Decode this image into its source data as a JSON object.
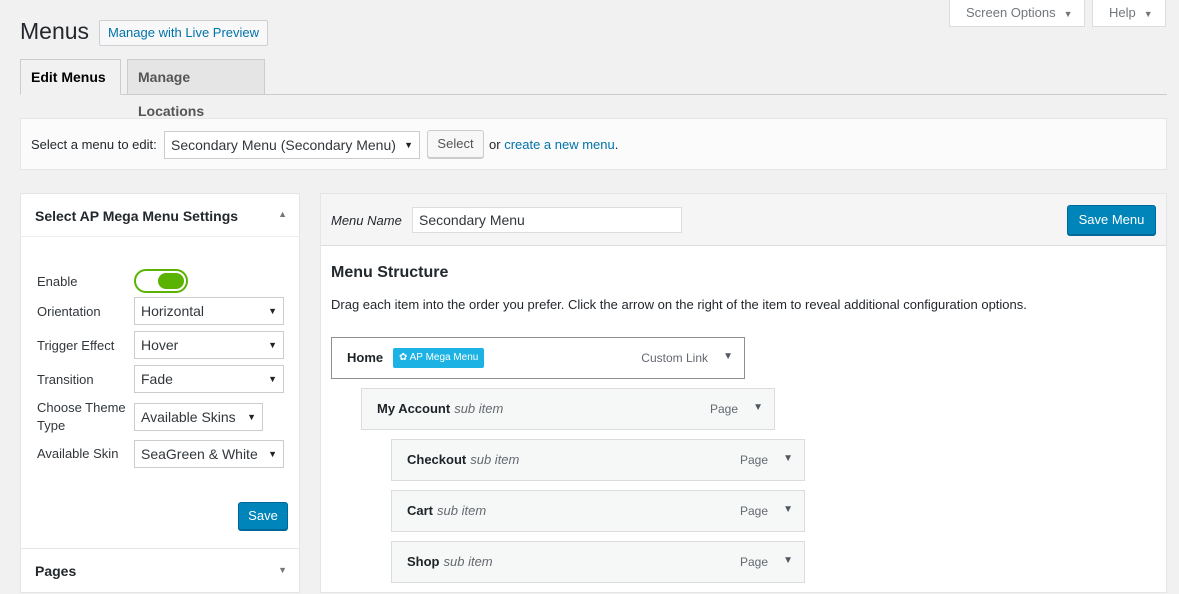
{
  "screen_options": {
    "label": "Screen Options"
  },
  "help": {
    "label": "Help"
  },
  "header": {
    "title": "Menus",
    "live_preview_label": "Manage with Live Preview"
  },
  "tabs": [
    {
      "label": "Edit Menus"
    },
    {
      "label": "Manage Locations"
    }
  ],
  "manage_menus": {
    "label": "Select a menu to edit:",
    "selected_menu": "Secondary Menu (Secondary Menu)",
    "select_button": "Select",
    "or_text": "or",
    "create_link": "create a new menu",
    "period": "."
  },
  "settings_panel": {
    "title": "Select AP Mega Menu Settings",
    "enable_label": "Enable",
    "enable_on": true,
    "fields": [
      {
        "label": "Orientation",
        "value": "Horizontal"
      },
      {
        "label": "Trigger Effect",
        "value": "Hover"
      },
      {
        "label": "Transition",
        "value": "Fade"
      },
      {
        "label": "Choose Theme Type",
        "value": "Available Skins"
      },
      {
        "label": "Available Skin",
        "value": "SeaGreen & White"
      }
    ],
    "save_label": "Save",
    "pages_title": "Pages"
  },
  "menu_editor": {
    "name_label": "Menu Name",
    "name_value": "Secondary Menu",
    "save_label": "Save Menu",
    "structure_title": "Menu Structure",
    "structure_desc": "Drag each item into the order you prefer. Click the arrow on the right of the item to reveal additional configuration options.",
    "items": [
      {
        "title": "Home",
        "badge": "AP Mega Menu",
        "type": "Custom Link",
        "sub": ""
      },
      {
        "title": "My Account",
        "type": "Page",
        "sub": "sub item"
      },
      {
        "title": "Checkout",
        "type": "Page",
        "sub": "sub item"
      },
      {
        "title": "Cart",
        "type": "Page",
        "sub": "sub item"
      },
      {
        "title": "Shop",
        "type": "Page",
        "sub": "sub item"
      }
    ]
  },
  "colors": {
    "primary": "#0085ba",
    "link": "#0073aa",
    "toggle": "#59b300",
    "badge": "#1cb3e4"
  },
  "icons": {
    "gear": "gear-icon",
    "caret": "caret-down-icon"
  }
}
